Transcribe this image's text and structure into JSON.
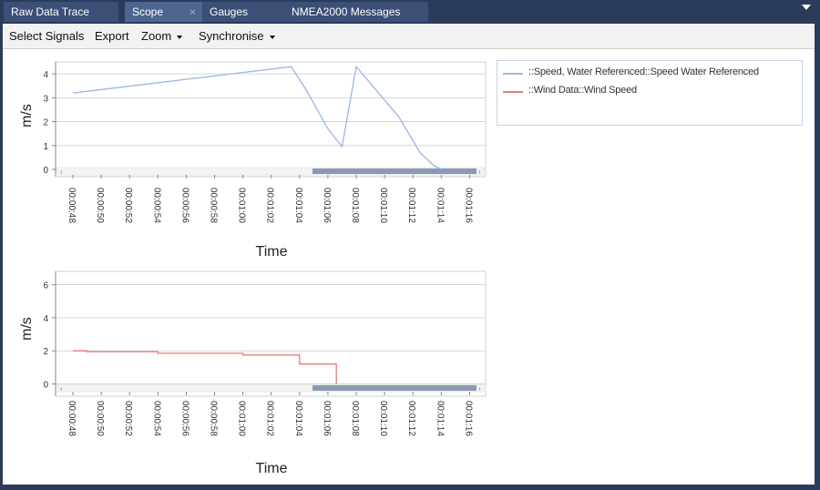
{
  "tabs": [
    {
      "label": "Raw Data Trace"
    },
    {
      "label": "Scope",
      "close": "×"
    },
    {
      "label": "Gauges"
    },
    {
      "label": "NMEA2000 Messages"
    }
  ],
  "toolbar": {
    "select_signals": "Select Signals",
    "export": "Export",
    "zoom": "Zoom",
    "synchronise": "Synchronise"
  },
  "legend": [
    {
      "label": "::Speed, Water Referenced::Speed Water Referenced",
      "color": "#9ab6e4"
    },
    {
      "label": "::Wind Data::Wind Speed",
      "color": "#e87b7b"
    }
  ],
  "icons": {
    "tab_menu": "chevron-down-icon",
    "dropdown": "caret-down-icon"
  },
  "chart_data": [
    {
      "type": "line",
      "ylabel": "m/s",
      "xlabel": "Time",
      "ylim": [
        0,
        4.5
      ],
      "yticks": [
        0,
        1,
        2,
        3,
        4
      ],
      "xticks": [
        "00:00:48",
        "00:00:50",
        "00:00:52",
        "00:00:54",
        "00:00:56",
        "00:00:58",
        "00:01:00",
        "00:01:02",
        "00:01:04",
        "00:01:06",
        "00:01:08",
        "00:01:10",
        "00:01:12",
        "00:01:14",
        "00:01:16"
      ],
      "grid": true,
      "series": [
        {
          "name": "::Speed, Water Referenced::Speed Water Referenced",
          "color": "#9ab6e4",
          "x": [
            48,
            63.4,
            64.5,
            66,
            67,
            68,
            71,
            72.5,
            73.5,
            74
          ],
          "y": [
            3.2,
            4.3,
            3.3,
            1.7,
            0.95,
            4.3,
            2.2,
            0.7,
            0.15,
            0.0
          ]
        }
      ]
    },
    {
      "type": "line",
      "ylabel": "m/s",
      "xlabel": "Time",
      "ylim": [
        -0.3,
        6.8
      ],
      "yticks": [
        0,
        2,
        4,
        6
      ],
      "xticks": [
        "00:00:48",
        "00:00:50",
        "00:00:52",
        "00:00:54",
        "00:00:56",
        "00:00:58",
        "00:01:00",
        "00:01:02",
        "00:01:04",
        "00:01:06",
        "00:01:08",
        "00:01:10",
        "00:01:12",
        "00:01:14",
        "00:01:16"
      ],
      "grid": true,
      "series": [
        {
          "name": "::Wind Data::Wind Speed",
          "color": "#e87b7b",
          "x": [
            48,
            49,
            49,
            54,
            54,
            60,
            60,
            64,
            64,
            66.6,
            66.6
          ],
          "y": [
            2.0,
            2.0,
            1.95,
            1.95,
            1.85,
            1.85,
            1.75,
            1.75,
            1.2,
            1.2,
            0.0
          ]
        }
      ]
    }
  ]
}
